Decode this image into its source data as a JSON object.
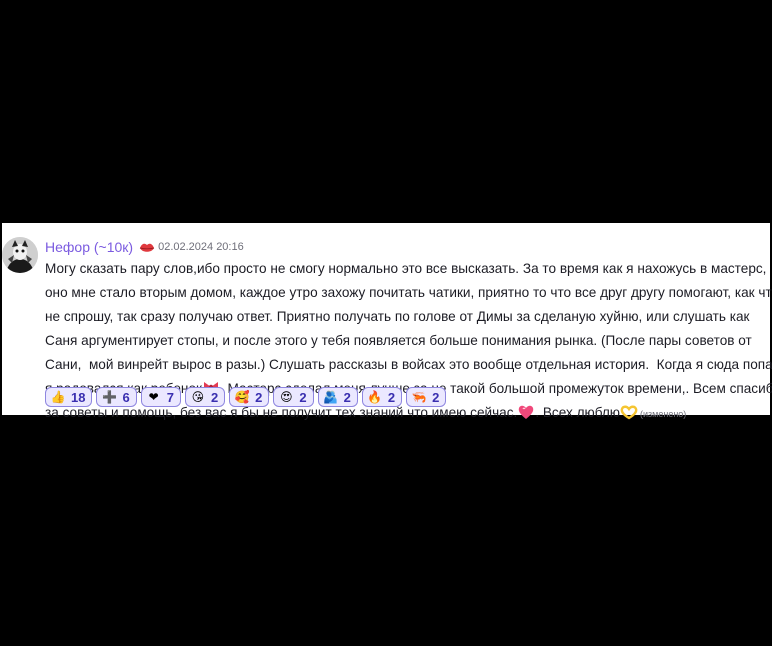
{
  "message": {
    "username": "Нефор (~10к)",
    "timestamp": "02.02.2024 20:16",
    "lines": [
      "Могу сказать пару слов,ибо просто не смогу нормально это все высказать. За то время как я нахожусь в мастерс,",
      "оно мне стало вторым домом, каждое утро захожу почитать чатики, приятно то что все друг другу помогают, как что",
      "не спрошу, так сразу получаю ответ. Приятно получать по голове от Димы за сделаную хуйню, или слушать как",
      "Саня аргументирует стопы, и после этого у тебя появляется больше понимания рынка. (После пары советов от",
      "Сани,  мой винрейт вырос в разы.) Слушать рассказы в войсах это вообще отдельная история.  Когда я сюда попал,"
    ],
    "line6_before": "я радовался как ребенок",
    "line6_after": ". Мастерс сделал меня лучше за не такой большой промежуток времени,. Всем спасибо",
    "line7_before": "за советы и помощь, без вас я бы не получит тех знаний что имею сейчас.",
    "line7_middle": ". Всех люблю",
    "edited_label": "(изменено)",
    "icons": {
      "badge": "red-lips-icon",
      "emoji1": "ribbon-bow-icon",
      "emoji2": "sparkling-heart-icon",
      "emoji3": "heart-hands-icon"
    }
  },
  "reactions": [
    {
      "icon": "thumbs-up-icon",
      "glyph": "👍",
      "count": "18"
    },
    {
      "icon": "plus-icon",
      "glyph": "➕",
      "count": "6"
    },
    {
      "icon": "red-heart-icon",
      "glyph": "❤",
      "count": "7"
    },
    {
      "icon": "kissing-face-icon",
      "glyph": "😘",
      "count": "2"
    },
    {
      "icon": "face-with-hearts-icon",
      "glyph": "🥰",
      "count": "2"
    },
    {
      "icon": "heart-eyes-icon",
      "glyph": "😍",
      "count": "2"
    },
    {
      "icon": "people-hugging-icon",
      "glyph": "🫂",
      "count": "2"
    },
    {
      "icon": "fire-icon",
      "glyph": "🔥",
      "count": "2"
    },
    {
      "icon": "shrimp-icon",
      "glyph": "🦐",
      "count": "2"
    }
  ],
  "colors": {
    "username": "#7b5be0",
    "reaction_bg": "#ebe8ff",
    "reaction_border": "#8e86e0",
    "reaction_text": "#3a2fb0"
  }
}
